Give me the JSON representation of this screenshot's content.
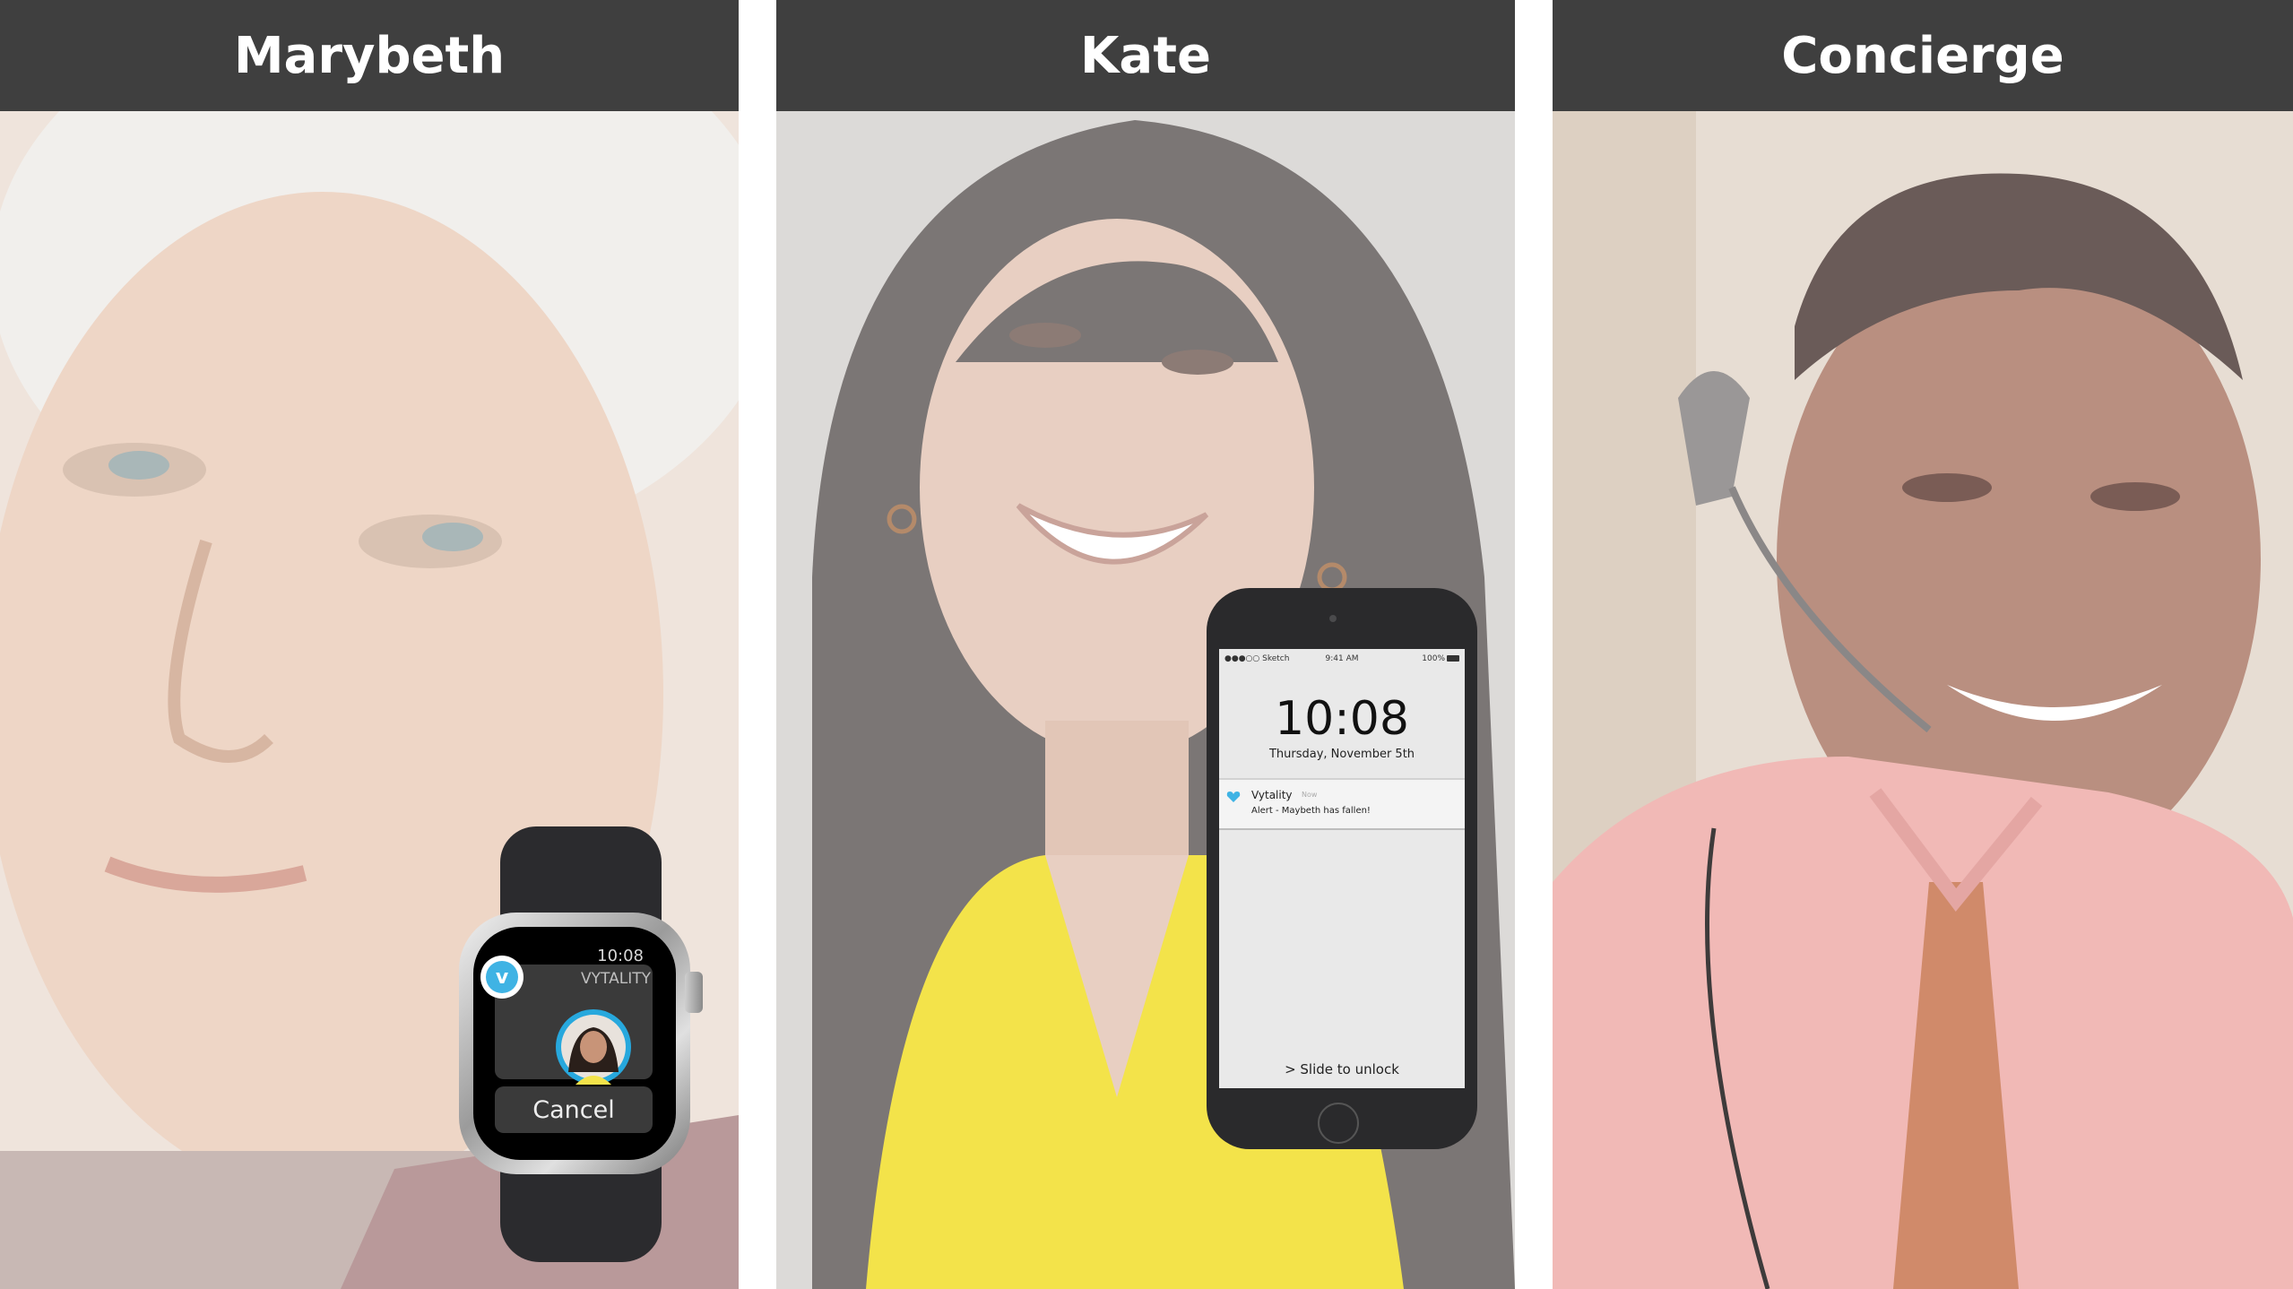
{
  "panels": [
    {
      "name": "Marybeth"
    },
    {
      "name": "Kate"
    },
    {
      "name": "Concierge"
    }
  ],
  "watch": {
    "time": "10:08",
    "app_name": "VYTALITY",
    "logo_glyph": "v",
    "cancel_label": "Cancel"
  },
  "phone": {
    "carrier": "●●●○○ Sketch",
    "status_time": "9:41 AM",
    "battery": "100%",
    "time": "10:08",
    "date": "Thursday, November 5th",
    "notification": {
      "app": "Vytality",
      "when": "Now",
      "message": "Alert - Maybeth has fallen!"
    },
    "slide_label": ">   Slide to unlock"
  },
  "colors": {
    "header_bg": "#3f3f3f",
    "accent": "#3fb3e4",
    "scarf": "#f3e34a",
    "shirt": "#f1b9b6"
  }
}
